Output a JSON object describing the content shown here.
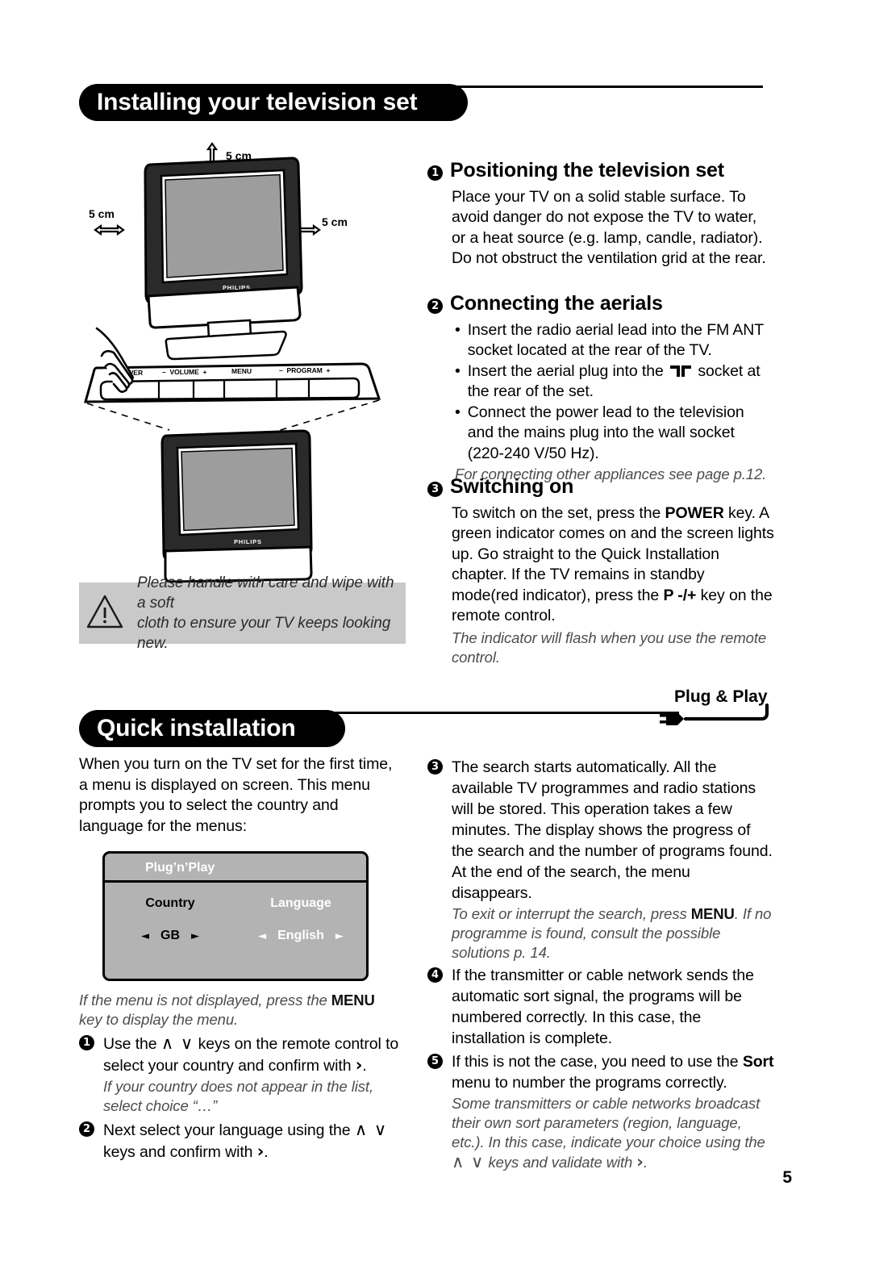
{
  "page": {
    "number": "5"
  },
  "sections": {
    "installing": {
      "banner_title": "Installing your television set"
    },
    "quick": {
      "banner_title": "Quick installation"
    }
  },
  "illustration": {
    "clearance_top": "5 cm",
    "clearance_left": "5 cm",
    "clearance_right": "5 cm",
    "brand": "PHILIPS",
    "control_panel": {
      "power": "POWER",
      "volume_minus": "–",
      "volume": "VOLUME",
      "volume_plus": "+",
      "menu": "MENU",
      "program_minus": "–",
      "program": "PROGRAM",
      "program_plus": "+"
    }
  },
  "warning": {
    "icon": "warning-triangle-icon",
    "line1": "Please handle with care and wipe with a soft",
    "line2": "cloth to ensure your TV keeps looking new."
  },
  "step1": {
    "number": "1",
    "title": "Positioning the television set",
    "body": "Place your TV on a solid stable surface. To avoid danger do not expose the TV to water, or a heat source (e.g. lamp, candle, radiator). Do not obstruct the ventilation grid at the rear."
  },
  "step2": {
    "number": "2",
    "title": "Connecting the aerials",
    "bullets": [
      {
        "text": "Insert the radio aerial lead into the FM ANT socket located at the rear of the TV."
      },
      {
        "pre": "Insert the aerial plug into the",
        "icon": "coax-socket-icon",
        "post": "socket at the rear of the set."
      },
      {
        "text": "Connect the power lead to the television and the mains plug into the wall socket (220-240 V/50 Hz)."
      }
    ],
    "note": "For connecting other appliances see page p.12."
  },
  "step3": {
    "number": "3",
    "title": "Switching on",
    "body_pre": "To switch on the set, press the ",
    "body_key1": "POWER",
    "body_mid": " key. A green indicator comes on and the screen lights up. Go straight to the Quick Installation chapter. If the TV remains in standby mode(red indicator), press the ",
    "body_key2": "P -/+",
    "body_post": " key on the remote control.",
    "note": "The indicator will flash when you use the remote control."
  },
  "quick_left": {
    "intro": "When you turn on the TV set for the first time, a menu is displayed on screen. This menu prompts you to select the country and language for the menus:",
    "osd": {
      "title": "Plug’n’Play",
      "country_label": "Country",
      "country_value": "GB",
      "language_label": "Language",
      "language_value": "English",
      "left_arrow": "◄",
      "right_arrow": "►"
    },
    "note_menu_pre": "If the menu is not displayed, press the ",
    "note_menu_key": "MENU",
    "note_menu_post": " key to display the menu.",
    "items": [
      {
        "number": "1",
        "pre": "Use the ",
        "keys": "∧ ∨",
        "mid": " keys on the remote control to select your country and confirm with ",
        "arrow": "›",
        "post": ".",
        "note": "If your country does not appear in the list, select choice “…”"
      },
      {
        "number": "2",
        "pre": "Next select your language using the ",
        "keys": "∧ ∨",
        "mid": " keys and confirm with ",
        "arrow": "›",
        "post": ".",
        "note": ""
      }
    ]
  },
  "quick_right": {
    "items": [
      {
        "number": "3",
        "text": "The search starts automatically. All the available TV programmes and radio stations will be stored. This operation takes a few minutes. The display shows the progress of the search and the number of programs found. At the end of the search, the menu disappears.",
        "note_pre": "To exit or interrupt the search, press ",
        "note_key": "MENU",
        "note_post": ". If no programme is found, consult the possible solutions p. 14."
      },
      {
        "number": "4",
        "text": "If the transmitter or cable network sends the automatic sort signal, the programs will be numbered correctly. In this case, the installation is complete.",
        "note_pre": "",
        "note_key": "",
        "note_post": ""
      },
      {
        "number": "5",
        "text_pre": "If this is not the case, you need to use the ",
        "text_key": "Sort",
        "text_post": " menu to number the programs correctly.",
        "note_pre": "Some transmitters or cable networks broadcast their own sort parameters (region, language, etc.). In this case, indicate your choice using the ",
        "note_keys": "∧ ∨",
        "note_mid": " keys and validate with ",
        "note_arrow": "›",
        "note_post": "."
      }
    ]
  },
  "pnp_logo": {
    "text": "Plug & Play",
    "icon": "power-plug-icon"
  }
}
